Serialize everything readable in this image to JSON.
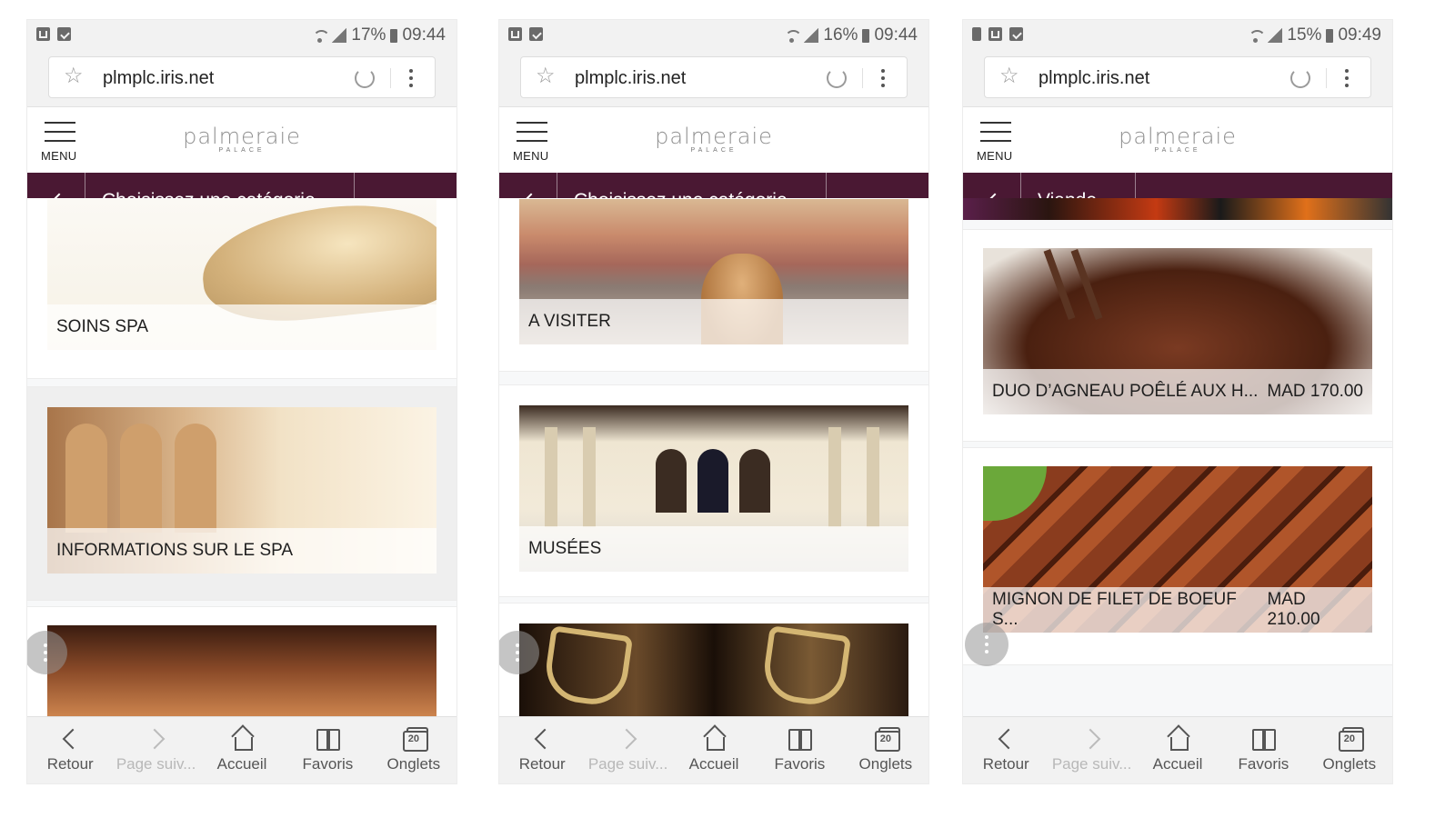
{
  "phones": [
    {
      "status": {
        "battery": "17%",
        "time": "09:44"
      },
      "url": "plmplc.iris.net",
      "menu_label": "MENU",
      "logo": {
        "name": "palmeraie",
        "sub": "PALACE"
      },
      "category": "Choisissez une catégorie",
      "cards": [
        {
          "label": "SOINS SPA"
        },
        {
          "label": "INFORMATIONS SUR LE SPA"
        }
      ]
    },
    {
      "status": {
        "battery": "16%",
        "time": "09:44"
      },
      "url": "plmplc.iris.net",
      "menu_label": "MENU",
      "logo": {
        "name": "palmeraie",
        "sub": "PALACE"
      },
      "category": "Choisissez une catégorie",
      "cards": [
        {
          "label": "A VISITER"
        },
        {
          "label": "MUSÉES"
        }
      ]
    },
    {
      "status": {
        "battery": "15%",
        "time": "09:49"
      },
      "url": "plmplc.iris.net",
      "menu_label": "MENU",
      "logo": {
        "name": "palmeraie",
        "sub": "PALACE"
      },
      "category": "Viande",
      "cards": [
        {
          "label": "DUO D’AGNEAU POÊLÉ AUX H...",
          "price": "MAD 170.00"
        },
        {
          "label": "MIGNON DE FILET DE BOEUF S...",
          "price": "MAD 210.00"
        }
      ]
    }
  ],
  "bottom_nav": [
    "Retour",
    "Page suiv...",
    "Accueil",
    "Favoris",
    "Onglets"
  ],
  "tabs_count": "20",
  "colors": {
    "category_bar": "#4a1833",
    "chrome": "#f2f2f2"
  }
}
